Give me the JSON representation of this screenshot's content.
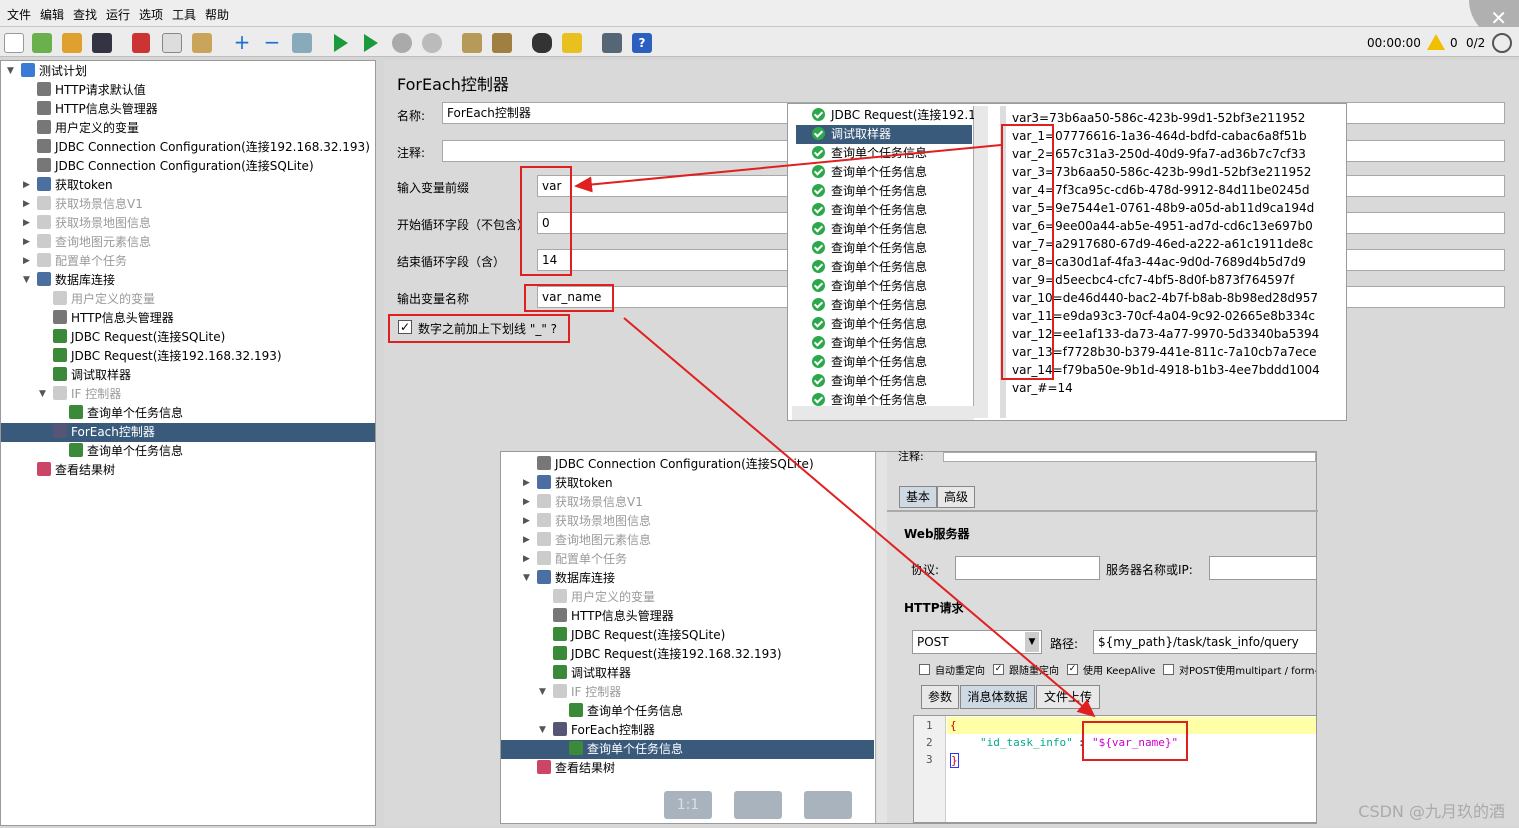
{
  "menu": [
    "文件",
    "编辑",
    "查找",
    "运行",
    "选项",
    "工具",
    "帮助"
  ],
  "status": {
    "time": "00:00:00",
    "warnings": "0",
    "threads": "0/2"
  },
  "tree": [
    {
      "label": "测试计划",
      "indent": 0,
      "arrow": "▼"
    },
    {
      "label": "HTTP请求默认值",
      "indent": 1
    },
    {
      "label": "HTTP信息头管理器",
      "indent": 1
    },
    {
      "label": "用户定义的变量",
      "indent": 1
    },
    {
      "label": "JDBC Connection Configuration(连接192.168.32.193)",
      "indent": 1
    },
    {
      "label": "JDBC Connection Configuration(连接SQLite)",
      "indent": 1
    },
    {
      "label": "获取token",
      "indent": 1,
      "arrow": "▶"
    },
    {
      "label": "获取场景信息V1",
      "indent": 1,
      "arrow": "▶",
      "disabled": true
    },
    {
      "label": "获取场景地图信息",
      "indent": 1,
      "arrow": "▶",
      "disabled": true
    },
    {
      "label": "查询地图元素信息",
      "indent": 1,
      "arrow": "▶",
      "disabled": true
    },
    {
      "label": "配置单个任务",
      "indent": 1,
      "arrow": "▶",
      "disabled": true
    },
    {
      "label": "数据库连接",
      "indent": 1,
      "arrow": "▼"
    },
    {
      "label": "用户定义的变量",
      "indent": 2,
      "disabled": true
    },
    {
      "label": "HTTP信息头管理器",
      "indent": 2
    },
    {
      "label": "JDBC Request(连接SQLite)",
      "indent": 2
    },
    {
      "label": "JDBC Request(连接192.168.32.193)",
      "indent": 2
    },
    {
      "label": "调试取样器",
      "indent": 2
    },
    {
      "label": "IF 控制器",
      "indent": 2,
      "arrow": "▼",
      "disabled": true
    },
    {
      "label": "查询单个任务信息",
      "indent": 3
    },
    {
      "label": "ForEach控制器",
      "indent": 2,
      "arrow": "▼",
      "selected": true
    },
    {
      "label": "查询单个任务信息",
      "indent": 3
    },
    {
      "label": "查看结果树",
      "indent": 1
    }
  ],
  "foreach": {
    "title": "ForEach控制器",
    "name_label": "名称:",
    "name_value": "ForEach控制器",
    "comment_label": "注释:",
    "prefix_label": "输入变量前缀",
    "prefix_value": "var",
    "start_label": "开始循环字段（不包含）",
    "start_value": "0",
    "end_label": "结束循环字段（含）",
    "end_value": "14",
    "output_label": "输出变量名称",
    "output_value": "var_name",
    "underscore_label": "数字之前加上下划线 \"_\" ?"
  },
  "result_list": [
    "JDBC Request(连接192.1",
    "调试取样器",
    "查询单个任务信息",
    "查询单个任务信息",
    "查询单个任务信息",
    "查询单个任务信息",
    "查询单个任务信息",
    "查询单个任务信息",
    "查询单个任务信息",
    "查询单个任务信息",
    "查询单个任务信息",
    "查询单个任务信息",
    "查询单个任务信息",
    "查询单个任务信息",
    "查询单个任务信息",
    "查询单个任务信息"
  ],
  "vars": [
    "var3=73b6aa50-586c-423b-99d1-52bf3e211952",
    "var_1=07776616-1a36-464d-bdfd-cabac6a8f51b",
    "var_2=657c31a3-250d-40d9-9fa7-ad36b7c7cf33",
    "var_3=73b6aa50-586c-423b-99d1-52bf3e211952",
    "var_4=7f3ca95c-cd6b-478d-9912-84d11be0245d",
    "var_5=9e7544e1-0761-48b9-a05d-ab11d9ca194d",
    "var_6=9ee00a44-ab5e-4951-ad7d-cd6c13e697b0",
    "var_7=a2917680-67d9-46ed-a222-a61c1911de8c",
    "var_8=ca30d1af-4fa3-44ac-9d0d-7689d4b5d7d9",
    "var_9=d5eecbc4-cfc7-4bf5-8d0f-b873f764597f",
    "var_10=de46d440-bac2-4b7f-b8ab-8b98ed28d957",
    "var_11=e9da93c3-70cf-4a04-9c92-02665e8b334c",
    "var_12=ee1af133-da73-4a77-9970-5d3340ba5394",
    "var_13=f7728b30-b379-441e-811c-7a10cb7a7ece",
    "var_14=f79ba50e-9b1d-4918-b1b3-4ee7bddd1004",
    "var_#=14"
  ],
  "tree2": [
    {
      "label": "JDBC Connection Configuration(连接SQLite)",
      "indent": 1
    },
    {
      "label": "获取token",
      "indent": 1,
      "arrow": "▶"
    },
    {
      "label": "获取场景信息V1",
      "indent": 1,
      "arrow": "▶",
      "disabled": true
    },
    {
      "label": "获取场景地图信息",
      "indent": 1,
      "arrow": "▶",
      "disabled": true
    },
    {
      "label": "查询地图元素信息",
      "indent": 1,
      "arrow": "▶",
      "disabled": true
    },
    {
      "label": "配置单个任务",
      "indent": 1,
      "arrow": "▶",
      "disabled": true
    },
    {
      "label": "数据库连接",
      "indent": 1,
      "arrow": "▼"
    },
    {
      "label": "用户定义的变量",
      "indent": 2,
      "disabled": true
    },
    {
      "label": "HTTP信息头管理器",
      "indent": 2
    },
    {
      "label": "JDBC Request(连接SQLite)",
      "indent": 2
    },
    {
      "label": "JDBC Request(连接192.168.32.193)",
      "indent": 2
    },
    {
      "label": "调试取样器",
      "indent": 2
    },
    {
      "label": "IF 控制器",
      "indent": 2,
      "arrow": "▼",
      "disabled": true
    },
    {
      "label": "查询单个任务信息",
      "indent": 3
    },
    {
      "label": "ForEach控制器",
      "indent": 2,
      "arrow": "▼"
    },
    {
      "label": "查询单个任务信息",
      "indent": 3,
      "selected": true
    },
    {
      "label": "查看结果树",
      "indent": 1
    }
  ],
  "http": {
    "comment_label": "注释:",
    "tab_basic": "基本",
    "tab_adv": "高级",
    "web_server": "Web服务器",
    "protocol_label": "协议:",
    "server_label": "服务器名称或IP:",
    "http_request": "HTTP请求",
    "method": "POST",
    "path_label": "路径:",
    "path_value": "${my_path}/task/task_info/query",
    "cb1": "自动重定向",
    "cb2": "跟随重定向",
    "cb3": "使用 KeepAlive",
    "cb4": "对POST使用multipart / form-d",
    "subtab_params": "参数",
    "subtab_body": "消息体数据",
    "subtab_upload": "文件上传",
    "line_nums": [
      "1",
      "2",
      "3"
    ],
    "code_open": "{",
    "code_key": "\"id_task_info\"",
    "code_colon": ":",
    "code_val": "\"${var_name}\"",
    "code_close": "}",
    "zoom_label": "1:1"
  },
  "watermark": "CSDN @九月玖的酒"
}
